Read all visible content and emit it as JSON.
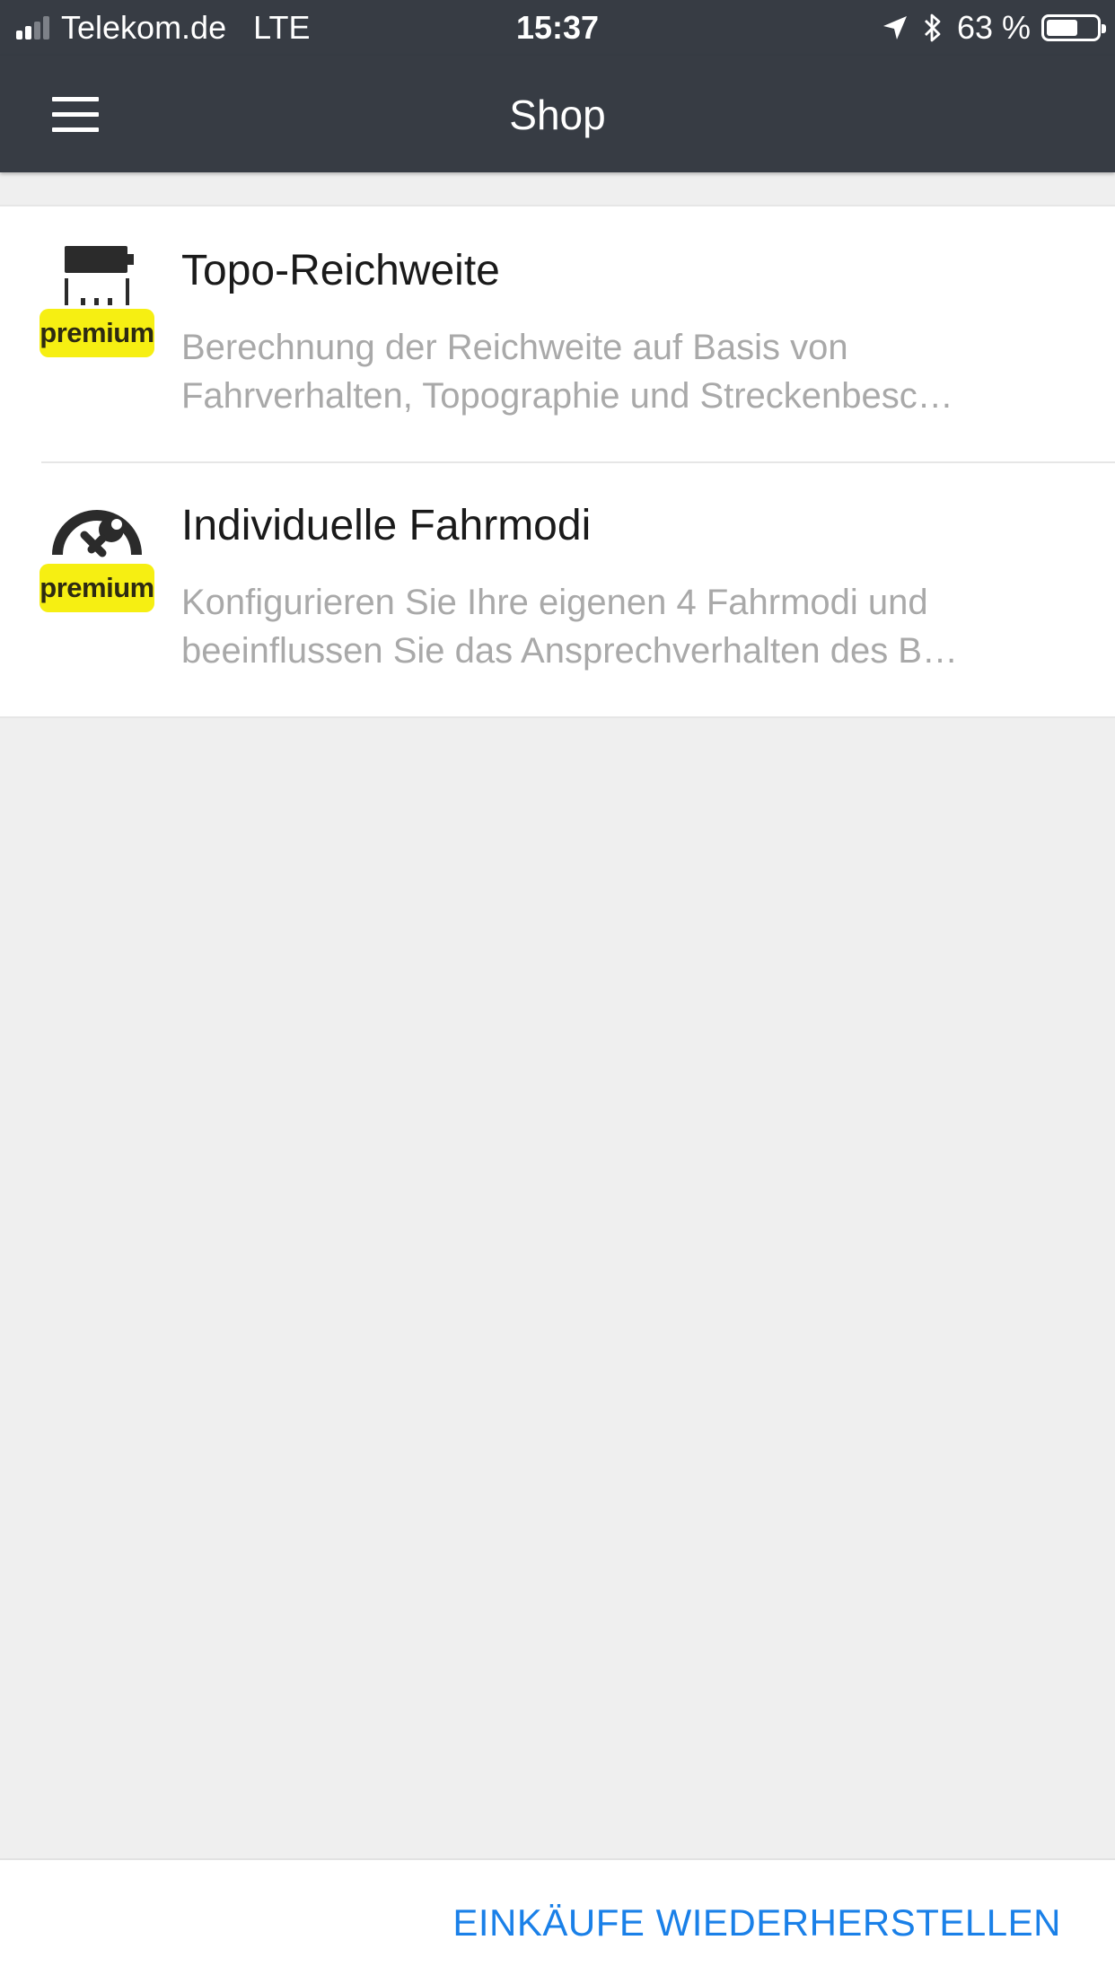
{
  "status_bar": {
    "carrier": "Telekom.de",
    "network": "LTE",
    "time": "15:37",
    "battery_percent_label": "63 %",
    "battery_level": 0.63,
    "signal_bars_filled": 2,
    "signal_bars_total": 4,
    "icons": [
      "signal-icon",
      "location-arrow-icon",
      "bluetooth-icon",
      "battery-icon"
    ]
  },
  "nav": {
    "title": "Shop",
    "menu_icon": "hamburger-menu-icon"
  },
  "products": [
    {
      "title": "Topo-Reichweite",
      "description_line1": "Berechnung der Reichweite auf Basis von",
      "description_line2": "Fahrverhalten, Topographie und Streckenbesc…",
      "badge": "premium",
      "icon": "battery-range-icon"
    },
    {
      "title": "Individuelle Fahrmodi",
      "description_line1": "Konfigurieren Sie Ihre eigenen 4 Fahrmodi und",
      "description_line2": "beeinflussen Sie das Ansprechverhalten des B…",
      "badge": "premium",
      "icon": "speedometer-wrench-icon"
    }
  ],
  "footer": {
    "restore_label": "EINKÄUFE WIEDERHERSTELLEN"
  },
  "colors": {
    "header_bg": "#373c44",
    "page_bg": "#efefef",
    "badge_yellow": "#f6ef12",
    "link_blue": "#1a80e8",
    "description_gray": "#a9a9a9"
  }
}
